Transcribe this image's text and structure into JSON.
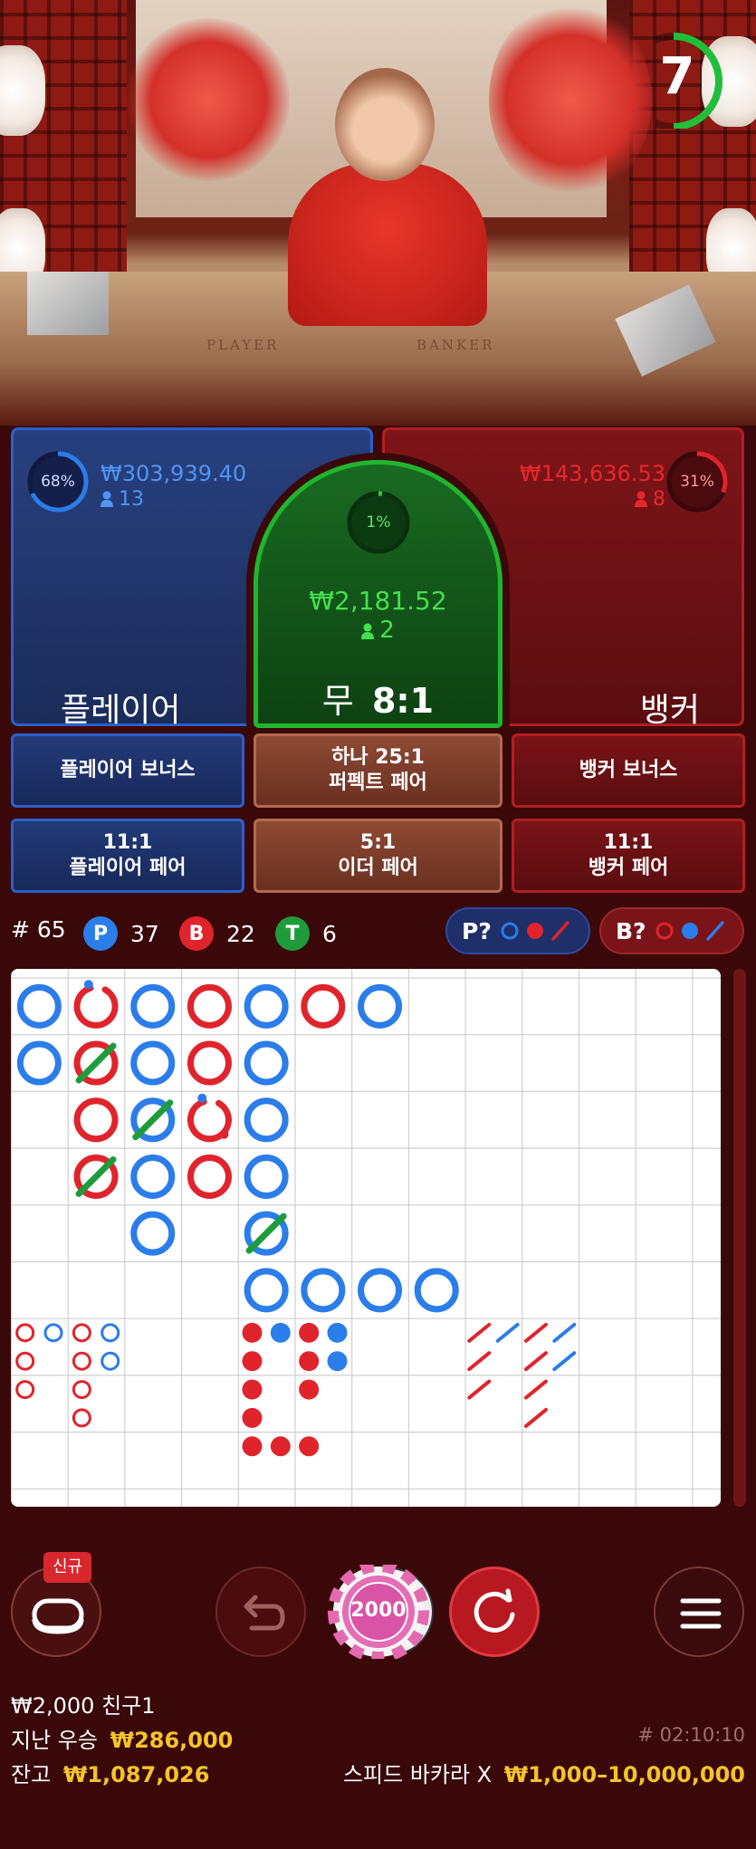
{
  "timer": {
    "seconds": "7"
  },
  "video": {
    "table_player": "PLAYER",
    "table_banker": "BANKER"
  },
  "player": {
    "percent": "68%",
    "amount": "₩303,939.40",
    "players": "13",
    "label": "플레이어",
    "ratio": 0.68
  },
  "banker": {
    "percent": "31%",
    "amount": "₩143,636.53",
    "players": "8",
    "label": "뱅커",
    "ratio": 0.31
  },
  "tie": {
    "percent": "1%",
    "amount": "₩2,181.52",
    "players": "2",
    "label": "무",
    "payout": "8:1",
    "ratio": 0.01
  },
  "side_bets": {
    "player_bonus": "플레이어 보너스",
    "perfect_pair_odds": "하나 25:1",
    "perfect_pair": "퍼펙트 페어",
    "banker_bonus": "뱅커 보너스",
    "player_pair_odds": "11:1",
    "player_pair": "플레이어 페어",
    "either_pair_odds": "5:1",
    "either_pair": "이더 페어",
    "banker_pair_odds": "11:1",
    "banker_pair": "뱅커 페어"
  },
  "stats": {
    "round": "# 65",
    "p_letter": "P",
    "p_count": "37",
    "b_letter": "B",
    "b_count": "22",
    "t_letter": "T",
    "t_count": "6",
    "predict_p": "P?",
    "predict_b": "B?"
  },
  "colors": {
    "player": "#2b7de9",
    "banker": "#e0242c",
    "tie": "#1e9c3c",
    "gold": "#f4c42a"
  },
  "big_road": [
    {
      "col": 0,
      "row": 0,
      "r": "P"
    },
    {
      "col": 0,
      "row": 1,
      "r": "P"
    },
    {
      "col": 1,
      "row": 0,
      "r": "B",
      "partial": true
    },
    {
      "col": 1,
      "row": 1,
      "r": "B",
      "tie": true
    },
    {
      "col": 1,
      "row": 2,
      "r": "B"
    },
    {
      "col": 1,
      "row": 3,
      "r": "B",
      "tie": true
    },
    {
      "col": 2,
      "row": 0,
      "r": "P"
    },
    {
      "col": 2,
      "row": 1,
      "r": "P"
    },
    {
      "col": 2,
      "row": 2,
      "r": "P",
      "tie": true
    },
    {
      "col": 2,
      "row": 3,
      "r": "P"
    },
    {
      "col": 2,
      "row": 4,
      "r": "P"
    },
    {
      "col": 3,
      "row": 0,
      "r": "B"
    },
    {
      "col": 3,
      "row": 1,
      "r": "B"
    },
    {
      "col": 3,
      "row": 2,
      "r": "B",
      "partial": true,
      "dot": true
    },
    {
      "col": 3,
      "row": 3,
      "r": "B"
    },
    {
      "col": 4,
      "row": 0,
      "r": "P"
    },
    {
      "col": 4,
      "row": 1,
      "r": "P"
    },
    {
      "col": 4,
      "row": 2,
      "r": "P"
    },
    {
      "col": 4,
      "row": 3,
      "r": "P"
    },
    {
      "col": 4,
      "row": 4,
      "r": "P",
      "tie": true
    },
    {
      "col": 4,
      "row": 5,
      "r": "P"
    },
    {
      "col": 5,
      "row": 0,
      "r": "B"
    },
    {
      "col": 5,
      "row": 5,
      "r": "P"
    },
    {
      "col": 6,
      "row": 0,
      "r": "P"
    },
    {
      "col": 6,
      "row": 5,
      "r": "P"
    },
    {
      "col": 7,
      "row": 5,
      "r": "P"
    }
  ],
  "big_eye_road": [
    {
      "x": 0,
      "y": 0,
      "c": "B"
    },
    {
      "x": 1,
      "y": 0,
      "c": "P"
    },
    {
      "x": 0,
      "y": 1,
      "c": "B"
    },
    {
      "x": 0,
      "y": 2,
      "c": "B"
    },
    {
      "x": 2,
      "y": 0,
      "c": "B"
    },
    {
      "x": 3,
      "y": 0,
      "c": "P"
    },
    {
      "x": 2,
      "y": 1,
      "c": "B"
    },
    {
      "x": 3,
      "y": 1,
      "c": "P"
    },
    {
      "x": 2,
      "y": 2,
      "c": "B"
    },
    {
      "x": 2,
      "y": 3,
      "c": "B"
    }
  ],
  "small_road": [
    {
      "x": 0,
      "y": 0,
      "c": "B"
    },
    {
      "x": 1,
      "y": 0,
      "c": "P"
    },
    {
      "x": 0,
      "y": 1,
      "c": "B"
    },
    {
      "x": 0,
      "y": 2,
      "c": "B"
    },
    {
      "x": 0,
      "y": 3,
      "c": "B"
    },
    {
      "x": 0,
      "y": 4,
      "c": "B"
    },
    {
      "x": 1,
      "y": 4,
      "c": "B"
    },
    {
      "x": 2,
      "y": 4,
      "c": "B"
    },
    {
      "x": 2,
      "y": 0,
      "c": "B"
    },
    {
      "x": 3,
      "y": 0,
      "c": "P"
    },
    {
      "x": 2,
      "y": 1,
      "c": "B"
    },
    {
      "x": 3,
      "y": 1,
      "c": "P"
    },
    {
      "x": 2,
      "y": 2,
      "c": "B"
    }
  ],
  "cockroach_road": [
    {
      "x": 0,
      "y": 0,
      "c": "B"
    },
    {
      "x": 1,
      "y": 0,
      "c": "P"
    },
    {
      "x": 0,
      "y": 1,
      "c": "B"
    },
    {
      "x": 0,
      "y": 2,
      "c": "B"
    },
    {
      "x": 2,
      "y": 0,
      "c": "B"
    },
    {
      "x": 3,
      "y": 0,
      "c": "P"
    },
    {
      "x": 2,
      "y": 1,
      "c": "B"
    },
    {
      "x": 3,
      "y": 1,
      "c": "P"
    },
    {
      "x": 2,
      "y": 2,
      "c": "B"
    },
    {
      "x": 2,
      "y": 3,
      "c": "B"
    }
  ],
  "controls": {
    "new_tag": "신규",
    "chip_value": "2000"
  },
  "footer": {
    "bet_line": "₩2,000 친구1",
    "last_win_label": "지난 우승",
    "last_win_value": "₩286,000",
    "round_id": "# 02:10:10",
    "balance_label": "잔고",
    "balance_value": "₩1,087,026",
    "game_name": "스피드 바카라 X",
    "limits": "₩1,000–10,000,000"
  }
}
